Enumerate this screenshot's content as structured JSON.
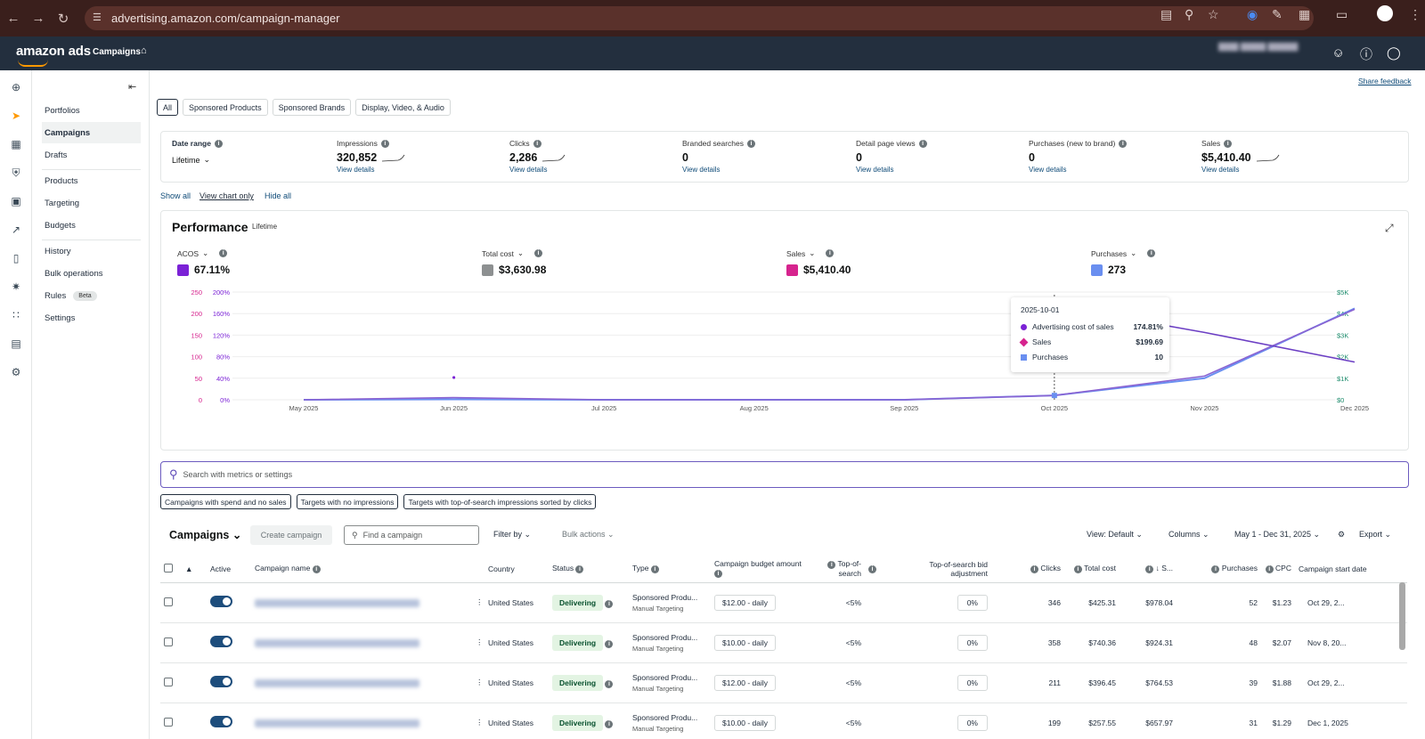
{
  "browser": {
    "url": "advertising.amazon.com/campaign-manager"
  },
  "app": {
    "logo": "amazon ads",
    "breadcrumb": "Campaigns",
    "share_feedback": "Share feedback"
  },
  "nav": {
    "items": [
      {
        "label": "Portfolios",
        "sel": false
      },
      {
        "label": "Campaigns",
        "sel": true
      },
      {
        "label": "Drafts",
        "sel": false
      },
      {
        "label": "Products",
        "sel": false
      },
      {
        "label": "Targeting",
        "sel": false
      },
      {
        "label": "Budgets",
        "sel": false
      },
      {
        "label": "History",
        "sel": false
      },
      {
        "label": "Bulk operations",
        "sel": false
      },
      {
        "label": "Rules",
        "sel": false,
        "badge": "Beta"
      },
      {
        "label": "Settings",
        "sel": false
      }
    ]
  },
  "tabs": [
    "All",
    "Sponsored Products",
    "Sponsored Brands",
    "Display, Video, & Audio"
  ],
  "metrics": {
    "date_range": {
      "label": "Date range",
      "value": "Lifetime"
    },
    "cards": [
      {
        "label": "Impressions",
        "value": "320,852",
        "link": "View details",
        "spark": true
      },
      {
        "label": "Clicks",
        "value": "2,286",
        "link": "View details",
        "spark": true
      },
      {
        "label": "Branded searches",
        "value": "0",
        "link": "View details",
        "spark": false
      },
      {
        "label": "Detail page views",
        "value": "0",
        "link": "View details",
        "spark": false
      },
      {
        "label": "Purchases (new to brand)",
        "value": "0",
        "link": "View details",
        "spark": false
      },
      {
        "label": "Sales",
        "value": "$5,410.40",
        "link": "View details",
        "spark": true
      }
    ]
  },
  "view_links": {
    "show_all": "Show all",
    "chart_only": "View chart only",
    "hide_all": "Hide all"
  },
  "performance": {
    "title": "Performance",
    "subtitle": "Lifetime",
    "metrics": [
      {
        "label": "ACOS",
        "value": "67.11%",
        "color": "#7b22d6"
      },
      {
        "label": "Total cost",
        "value": "$3,630.98",
        "color": "#8d9091"
      },
      {
        "label": "Sales",
        "value": "$5,410.40",
        "color": "#d6248e"
      },
      {
        "label": "Purchases",
        "value": "273",
        "color": "#6a8ff0"
      }
    ],
    "tooltip": {
      "date": "2025-10-01",
      "rows": [
        {
          "name": "Advertising cost of sales",
          "value": "174.81%",
          "color": "#7b22d6",
          "shape": "circle"
        },
        {
          "name": "Sales",
          "value": "$199.69",
          "color": "#d6248e",
          "shape": "diamond"
        },
        {
          "name": "Purchases",
          "value": "10",
          "color": "#6a8ff0",
          "shape": "square"
        }
      ]
    }
  },
  "chart_data": {
    "type": "line",
    "x": [
      "May 2025",
      "Jun 2025",
      "Jul 2025",
      "Aug 2025",
      "Sep 2025",
      "Oct 2025",
      "Nov 2025",
      "Dec 2025"
    ],
    "y_left_ticks_count": [
      "0",
      "50",
      "100",
      "150",
      "200",
      "250"
    ],
    "y_left_ticks_pct": [
      "0%",
      "40%",
      "80%",
      "120%",
      "160%",
      "200%"
    ],
    "y_right_ticks": [
      "$0",
      "$1K",
      "$2K",
      "$3K",
      "$4K",
      "$5K"
    ],
    "series": [
      {
        "name": "Purchases",
        "color": "#6a8ff0",
        "values": [
          0,
          1,
          0,
          0,
          0,
          10,
          50,
          212
        ]
      },
      {
        "name": "Sales",
        "color": "#8a63d2",
        "values": [
          0,
          100,
          0,
          0,
          0,
          199.69,
          1100,
          4200
        ]
      },
      {
        "name": "ACOS",
        "color": "#6c3fc4",
        "values": [
          null,
          null,
          null,
          null,
          null,
          174.81,
          125,
          70
        ]
      }
    ],
    "grid": true,
    "tooltip_x": "Oct 2025"
  },
  "search": {
    "placeholder": "Search with metrics or settings"
  },
  "chips": [
    "Campaigns with spend and no sales",
    "Targets with no impressions",
    "Targets with top-of-search impressions sorted by clicks"
  ],
  "campaigns_toolbar": {
    "title": "Campaigns",
    "create": "Create campaign",
    "find": "Find a campaign",
    "filter": "Filter by",
    "bulk": "Bulk actions",
    "view": "View: Default",
    "columns": "Columns",
    "date": "May 1 - Dec 31, 2025",
    "export": "Export"
  },
  "table": {
    "headers": {
      "active": "Active",
      "name": "Campaign name",
      "country": "Country",
      "status": "Status",
      "type": "Type",
      "budget": "Campaign budget amount",
      "tos": "Top-of-search",
      "tosbid": "Top-of-search bid adjustment",
      "clicks": "Clicks",
      "cost": "Total cost",
      "sales": "S...",
      "purchases": "Purchases",
      "cpc": "CPC",
      "start": "Campaign start date"
    },
    "rows": [
      {
        "country": "United States",
        "status": "Delivering",
        "type": "Sponsored Produ...",
        "subtype": "Manual Targeting",
        "budget": "$12.00 - daily",
        "tos": "<5%",
        "tosbid": "0%",
        "clicks": "346",
        "cost": "$425.31",
        "sales": "$978.04",
        "purchases": "52",
        "cpc": "$1.23",
        "start": "Oct 29, 2..."
      },
      {
        "country": "United States",
        "status": "Delivering",
        "type": "Sponsored Produ...",
        "subtype": "Manual Targeting",
        "budget": "$10.00 - daily",
        "tos": "<5%",
        "tosbid": "0%",
        "clicks": "358",
        "cost": "$740.36",
        "sales": "$924.31",
        "purchases": "48",
        "cpc": "$2.07",
        "start": "Nov 8, 20..."
      },
      {
        "country": "United States",
        "status": "Delivering",
        "type": "Sponsored Produ...",
        "subtype": "Manual Targeting",
        "budget": "$12.00 - daily",
        "tos": "<5%",
        "tosbid": "0%",
        "clicks": "211",
        "cost": "$396.45",
        "sales": "$764.53",
        "purchases": "39",
        "cpc": "$1.88",
        "start": "Oct 29, 2..."
      },
      {
        "country": "United States",
        "status": "Delivering",
        "type": "Sponsored Produ...",
        "subtype": "Manual Targeting",
        "budget": "$10.00 - daily",
        "tos": "<5%",
        "tosbid": "0%",
        "clicks": "199",
        "cost": "$257.55",
        "sales": "$657.97",
        "purchases": "31",
        "cpc": "$1.29",
        "start": "Dec 1, 2025"
      }
    ]
  }
}
